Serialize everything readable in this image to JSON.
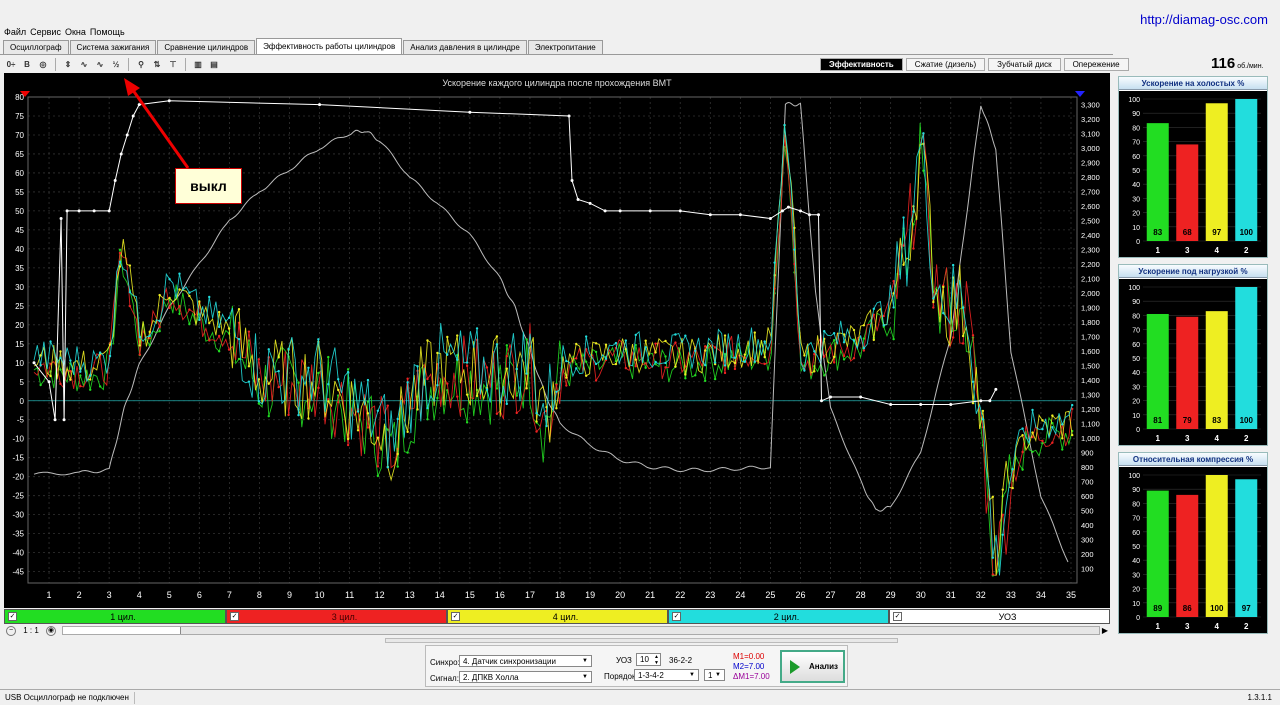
{
  "site_url": "http://diamag-osc.com",
  "menu": [
    "Файл",
    "Сервис",
    "Окна",
    "Помощь"
  ],
  "tabs": [
    "Осциллограф",
    "Система зажигания",
    "Сравнение цилиндров",
    "Эффективность работы цилиндров",
    "Анализ давления в цилиндре",
    "Электропитание"
  ],
  "active_tab": 3,
  "toolbar_icons": [
    "zero-axis-icon",
    "bold-b-icon",
    "search-rpm-icon",
    "scale-icon",
    "wave-icon",
    "wave-vvt-icon",
    "ratio-icon",
    "sync-icon",
    "marker-icon",
    "cursor-icon",
    "cylinders-icon",
    "table-icon"
  ],
  "toolbar_glyphs": [
    "0÷",
    "B",
    "◎",
    "⇕",
    "∿",
    "∿",
    "½",
    "⚲",
    "⇅",
    "⊤",
    "▥",
    "▤"
  ],
  "right_tabs": [
    "Эффективность",
    "Сжатие (дизель)",
    "Зубчатый диск",
    "Опережение"
  ],
  "active_right_tab": 0,
  "rpm": {
    "value": "116",
    "unit": "об./мин."
  },
  "annotation": "выкл",
  "chart_data": [
    {
      "type": "line",
      "title": "Ускорение каждого цилиндра после прохождения ВМТ",
      "xlim": [
        0.3,
        35.2
      ],
      "ylim_left": [
        -48,
        80
      ],
      "ylim_right": [
        0,
        3350
      ],
      "x_ticks": [
        1,
        2,
        3,
        4,
        5,
        6,
        7,
        8,
        9,
        10,
        11,
        12,
        13,
        14,
        15,
        16,
        17,
        18,
        19,
        20,
        21,
        22,
        23,
        24,
        25,
        26,
        27,
        28,
        29,
        30,
        31,
        32,
        33,
        34,
        35
      ],
      "y_ticks_left": [
        80,
        75,
        70,
        65,
        60,
        55,
        50,
        45,
        40,
        35,
        30,
        25,
        20,
        15,
        10,
        5,
        0,
        -5,
        -10,
        -15,
        -20,
        -25,
        -30,
        -35,
        -40,
        -45
      ],
      "y_ticks_right": [
        "3,300",
        "3,200",
        "3,100",
        "3,000",
        "2,900",
        "2,800",
        "2,700",
        "2,600",
        "2,500",
        "2,400",
        "2,300",
        "2,200",
        "2,100",
        "2,000",
        "1,900",
        "1,800",
        "1,700",
        "1,600",
        "1,500",
        "1,400",
        "1,300",
        "1,200",
        "1,100",
        "1,000",
        "900",
        "800",
        "700",
        "600",
        "500",
        "400",
        "300",
        "200",
        "100"
      ],
      "grid": true,
      "series": [
        {
          "name": "1 цил.",
          "color": "#22dd22",
          "axis": "left"
        },
        {
          "name": "3 цил.",
          "color": "#ee2222",
          "axis": "left"
        },
        {
          "name": "4 цил.",
          "color": "#eeee22",
          "axis": "left"
        },
        {
          "name": "2 цил.",
          "color": "#22dddd",
          "axis": "left"
        },
        {
          "name": "УОЗ",
          "color": "#ffffff",
          "axis": "left",
          "x": [
            0.5,
            1,
            1.2,
            1.4,
            1.5,
            1.6,
            2,
            2.5,
            3,
            3.2,
            3.4,
            3.6,
            3.8,
            4,
            5,
            10,
            15,
            18.3,
            18.4,
            18.6,
            19,
            19.5,
            20,
            21,
            22,
            23,
            24,
            25,
            25.4,
            25.6,
            26,
            26.3,
            26.6,
            26.7,
            27,
            28,
            29,
            30,
            31,
            32,
            32.3,
            32.5
          ],
          "y": [
            10,
            5,
            -5,
            48,
            -5,
            50,
            50,
            50,
            50,
            58,
            65,
            70,
            75,
            78,
            79,
            78,
            76,
            75,
            58,
            53,
            52,
            50,
            50,
            50,
            50,
            49,
            49,
            48,
            50,
            51,
            50,
            49,
            49,
            0,
            1,
            1,
            -1,
            -1,
            -1,
            0,
            0,
            3
          ]
        },
        {
          "name": "",
          "color": "#bbbbbb",
          "axis": "right",
          "x": [
            0.5,
            2,
            3,
            3.5,
            4,
            5,
            6,
            7,
            8,
            9,
            10,
            11,
            11.5,
            12,
            13,
            14,
            15,
            16,
            16.5,
            17,
            17.5,
            18,
            19,
            20,
            21,
            22,
            23,
            24,
            25,
            25.5,
            26,
            26.5,
            27,
            28,
            28.5,
            29,
            30,
            31,
            31.5,
            32,
            32.5,
            33,
            34,
            35
          ],
          "y": [
            750,
            760,
            780,
            1200,
            1500,
            1900,
            2200,
            2500,
            2700,
            2850,
            3000,
            3100,
            3120,
            3050,
            2800,
            2600,
            2400,
            2100,
            1900,
            1600,
            1300,
            1100,
            950,
            850,
            800,
            780,
            780,
            790,
            800,
            3300,
            3300,
            2000,
            1200,
            700,
            500,
            520,
            900,
            1700,
            2500,
            3300,
            3000,
            1600,
            600,
            100
          ]
        }
      ]
    },
    {
      "type": "bar",
      "title": "Ускорение на холостых %",
      "categories": [
        "1",
        "3",
        "4",
        "2"
      ],
      "values": [
        83,
        68,
        97,
        100
      ],
      "ylim": [
        0,
        100
      ],
      "colors": [
        "#22dd22",
        "#ee2222",
        "#eeee22",
        "#22dddd"
      ]
    },
    {
      "type": "bar",
      "title": "Ускорение под нагрузкой %",
      "categories": [
        "1",
        "3",
        "4",
        "2"
      ],
      "values": [
        81,
        79,
        83,
        100
      ],
      "ylim": [
        0,
        100
      ],
      "colors": [
        "#22dd22",
        "#ee2222",
        "#eeee22",
        "#22dddd"
      ]
    },
    {
      "type": "bar",
      "title": "Относительная компрессия %",
      "categories": [
        "1",
        "3",
        "4",
        "2"
      ],
      "values": [
        89,
        86,
        100,
        97
      ],
      "ylim": [
        0,
        100
      ],
      "colors": [
        "#22dd22",
        "#ee2222",
        "#eeee22",
        "#22dddd"
      ]
    }
  ],
  "legend": [
    {
      "label": "1 цил.",
      "color": "#22dd22",
      "checked": true
    },
    {
      "label": "3 цил.",
      "color": "#ee2222",
      "checked": true
    },
    {
      "label": "4 цил.",
      "color": "#eeee22",
      "checked": true
    },
    {
      "label": "2 цил.",
      "color": "#22dddd",
      "checked": true
    },
    {
      "label": "УОЗ",
      "color": "#ffffff",
      "checked": true
    }
  ],
  "zoom_label": "1 : 1",
  "controls": {
    "sync_label": "Синхро:",
    "sync_value": "4. Датчик синхронизации",
    "signal_label": "Сигнал:",
    "signal_value": "2. ДПКВ Холла",
    "uoz_label": "УОЗ",
    "uoz_value": "10",
    "wheel": "36-2-2",
    "order_label": "Порядок",
    "order_value": "1-3-4-2",
    "order_extra": "1",
    "m1": "M1=0.00",
    "m2": "M2=7.00",
    "dm1": "ΔM1=7.00",
    "analyze": "Анализ"
  },
  "status": "USB Осциллограф не подключен",
  "version": "1.3.1.1"
}
